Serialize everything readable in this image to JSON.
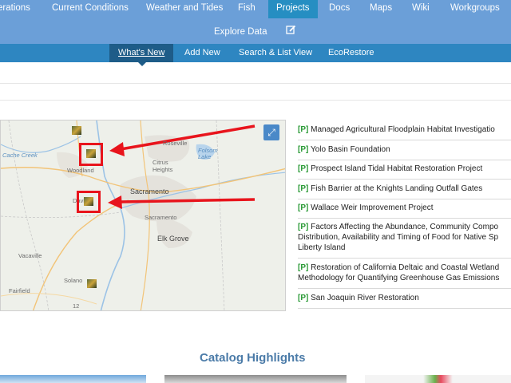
{
  "nav": {
    "items": [
      {
        "label": "erations"
      },
      {
        "label": "Current Conditions"
      },
      {
        "label": "Weather and Tides"
      },
      {
        "label": "Fish"
      },
      {
        "label": "Projects"
      },
      {
        "label": "Docs"
      },
      {
        "label": "Maps"
      },
      {
        "label": "Wiki"
      },
      {
        "label": "Workgroups"
      }
    ],
    "row2": {
      "explore": "Explore Data",
      "edit_icon": "edit-icon"
    },
    "active": "Projects",
    "colors": {
      "nav_bg": "#6b9fd8",
      "active_bg": "#268ec2"
    }
  },
  "subnav": {
    "items": [
      {
        "label": "What's New"
      },
      {
        "label": "Add New"
      },
      {
        "label": "Search & List View"
      },
      {
        "label": "EcoRestore"
      }
    ],
    "active": "What's New",
    "colors": {
      "bg": "#2e86c1",
      "active_bg": "#1e5c88"
    }
  },
  "map": {
    "labels": {
      "cache_creek": "Cache Creek",
      "roseville": "Roseville",
      "folsom_lake": "Folsom Lake",
      "citrus_heights": "Citrus Heights",
      "woodland": "Woodland",
      "sacramento": "Sacramento",
      "davis": "Davis",
      "elk_grove": "Elk Grove",
      "vacaville": "Vacaville",
      "fairfield": "Fairfield",
      "solano": "Solano",
      "route": "12"
    },
    "expand_icon": "expand-icon",
    "annotation_color": "#e8141c"
  },
  "projects": {
    "tag": "[P]",
    "items": [
      {
        "name": "Managed Agricultural Floodplain Habitat Investigatio"
      },
      {
        "name": "Yolo Basin Foundation"
      },
      {
        "name": "Prospect Island Tidal Habitat Restoration Project"
      },
      {
        "name": "Fish Barrier at the Knights Landing Outfall Gates"
      },
      {
        "name": "Wallace Weir Improvement Project"
      },
      {
        "name": "Factors Affecting the Abundance, Community Compo",
        "line2": "Distribution, Availability and Timing of Food for Native Sp",
        "line3": "Liberty Island"
      },
      {
        "name": "Restoration of California Deltaic and Coastal Wetland",
        "line2": "Methodology for Quantifying Greenhouse Gas Emissions"
      },
      {
        "name": "San Joaquin River Restoration"
      }
    ]
  },
  "catalog": {
    "title": "Catalog Highlights"
  }
}
